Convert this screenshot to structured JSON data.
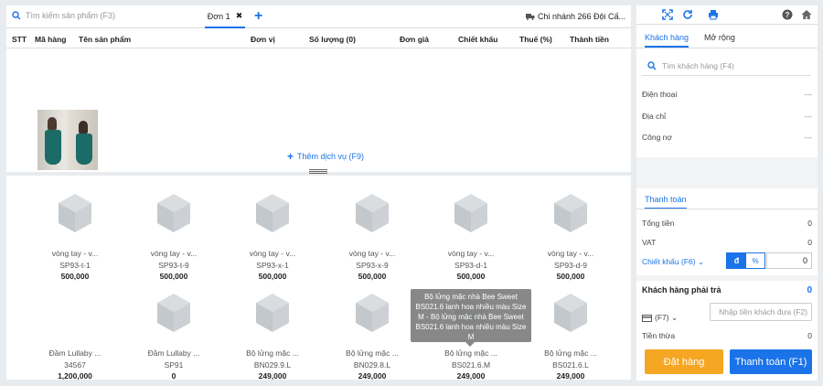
{
  "search": {
    "placeholder": "Tìm kiếm sản phẩm (F3)"
  },
  "order_tab": {
    "label": "Đơn 1",
    "close": "✖"
  },
  "add_tab_label": "+",
  "branch": "Chi nhánh 266 Đội Cấ...",
  "table_headers": [
    "STT",
    "Mã hàng",
    "Tên sản phẩm",
    "Đơn vị",
    "Số lượng (0)",
    "Đơn giá",
    "Chiết khấu",
    "Thuế (%)",
    "Thành tiền"
  ],
  "add_service": "Thêm dịch vụ (F9)",
  "products": [
    {
      "name": "vòng tay - v...",
      "code": "SP93-t-1",
      "price": "500,000"
    },
    {
      "name": "vòng tay - v...",
      "code": "SP93-t-9",
      "price": "500,000"
    },
    {
      "name": "vòng tay - v...",
      "code": "SP93-x-1",
      "price": "500,000"
    },
    {
      "name": "vòng tay - v...",
      "code": "SP93-x-9",
      "price": "500,000"
    },
    {
      "name": "vòng tay - v...",
      "code": "SP93-d-1",
      "price": "500,000"
    },
    {
      "name": "vòng tay - v...",
      "code": "SP93-d-9",
      "price": "500,000"
    },
    {
      "name": "Đầm Lullaby ...",
      "code": "34567",
      "price": "1,200,000",
      "has_photo": true
    },
    {
      "name": "Đầm Lullaby ...",
      "code": "SP91",
      "price": "0"
    },
    {
      "name": "Bộ lửng mặc ...",
      "code": "BN029.9.L",
      "price": "249,000"
    },
    {
      "name": "Bộ lửng mặc ...",
      "code": "BN029.8.L",
      "price": "249,000"
    },
    {
      "name": "Bộ lửng mặc ...",
      "code": "BS021.6.M",
      "price": "249,000"
    },
    {
      "name": "Bộ lửng mặc ...",
      "code": "BS021.6.L",
      "price": "249,000"
    }
  ],
  "tooltip": "Bộ lửng mặc nhà Bee Sweet BS021.6 lanh hoa nhiều màu Size M - Bộ lửng mặc nhà Bee Sweet BS021.6 lanh hoa nhiều màu Size M",
  "right": {
    "tabs": [
      "Khách hàng",
      "Mở rộng"
    ],
    "customer_search_placeholder": "Tìm khách hàng (F4)",
    "info": [
      {
        "label": "Điện thoại",
        "value": "---"
      },
      {
        "label": "Địa chỉ",
        "value": "---"
      },
      {
        "label": "Công nợ",
        "value": "---"
      }
    ],
    "payment_tab": "Thanh toán",
    "totals": [
      {
        "label": "Tổng tiền",
        "value": "0"
      },
      {
        "label": "VAT",
        "value": "0"
      }
    ],
    "discount_label": "Chiết khấu (F6) ⌄",
    "discount_mode_d": "đ",
    "discount_mode_pct": "%",
    "discount_value": "0",
    "payable_label": "Khách hàng phải trả",
    "payable_value": "0",
    "f7_label": "(F7) ⌄",
    "cash_placeholder": "Nhập tiền khách đưa (F2)",
    "change_label": "Tiền thừa",
    "change_value": "0",
    "btn_order": "Đặt hàng",
    "btn_pay": "Thanh toán (F1)"
  },
  "colors": {
    "accent": "#1a73e8",
    "order_button": "#f5a623",
    "background": "#e9ecef"
  },
  "icons": [
    "search-icon",
    "close-icon",
    "plus-icon",
    "truck-icon",
    "fullscreen-icon",
    "refresh-icon",
    "print-icon",
    "help-icon",
    "home-icon",
    "box-icon",
    "credit-card-icon"
  ]
}
